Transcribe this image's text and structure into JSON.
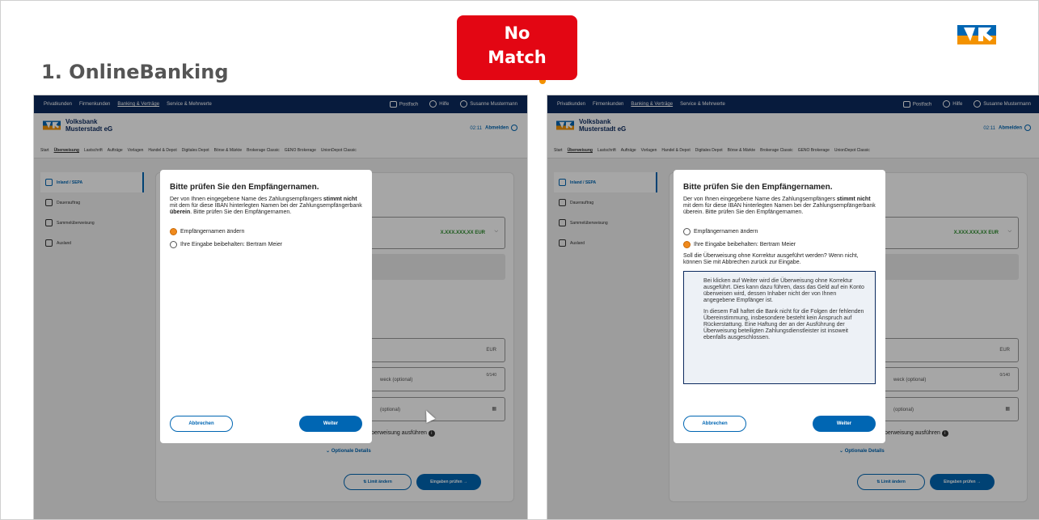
{
  "slide": {
    "title": "1. OnlineBanking",
    "badge_line1": "No",
    "badge_line2": "Match"
  },
  "colors": {
    "accent_red": "#e30613",
    "nav_blue": "#0c2a5f",
    "primary_blue": "#0066b3",
    "radio_selected": "#f08a1d"
  },
  "app": {
    "topnav": [
      "Privatkunden",
      "Firmenkunden",
      "Banking & Verträge",
      "Service & Mehrwerte"
    ],
    "topnav_active": "Banking & Verträge",
    "postfach": "Postfach",
    "hilfe": "Hilfe",
    "user": "Susanne Mustermann",
    "bank_line1": "Volksbank",
    "bank_line2": "Musterstadt eG",
    "session_time": "02:11",
    "logout": "Abmelden",
    "subnav": [
      "Start",
      "Überweisung",
      "Lastschrift",
      "Aufträge",
      "Vorlagen",
      "Handel & Depot",
      "Digitales Depot",
      "Börse & Märkte",
      "Brokerage Classic",
      "GENO Brokerage",
      "UnionDepot Classic"
    ],
    "sidebar": [
      "Inland / SEPA",
      "Dauerauftrag",
      "Sammelüberweisung",
      "Ausland"
    ],
    "account_value": "X.XXX.XXX,XX EUR",
    "amount_currency": "EUR",
    "purpose_placeholder": "weck (optional)",
    "purpose_counter": "0/140",
    "date_placeholder": "(optional)",
    "execute_label": "berweisung ausführen",
    "optional_details": "Optionale Details",
    "limit_button": "Limit ändern",
    "check_button": "Eingaben prüfen"
  },
  "modal": {
    "title": "Bitte prüfen Sie den Empfängernamen.",
    "msg_part1": "Der von Ihnen eingegebene Name des Zahlungsempfängers ",
    "msg_bold1": "stimmt nicht",
    "msg_part2": " mit dem für diese IBAN hinterlegten Namen bei der Zahlungsempfängerbank ",
    "msg_bold2": "überein",
    "msg_part3": ". Bitte prüfen Sie den Empfängernamen.",
    "option_change": "Empfängernamen ändern",
    "option_keep": "Ihre Eingabe beibehalten: Bertram Meier",
    "question": "Soll die Überweisung ohne Korrektur ausgeführt werden? Wenn nicht, können Sie mit Abbrechen zurück zur Eingabe.",
    "info_p1": "Bei klicken auf Weiter wird die Überweisung ohne Korrektur ausgeführt. Dies kann dazu führen, dass das Geld auf ein Konto überweisen wird, dessen Inhaber nicht der von Ihnen angegebene Empfänger ist.",
    "info_p2": "In diesem Fall haftet die Bank nicht für die Folgen der fehlenden Übereinstimmung, insbesondere besteht kein Anspruch auf Rückerstattung. Eine Haftung der an der Ausführung der Überweisung beteiligten Zahlungsdienstleister ist insoweit ebenfalls ausgeschlossen.",
    "cancel": "Abbrechen",
    "next": "Weiter"
  }
}
